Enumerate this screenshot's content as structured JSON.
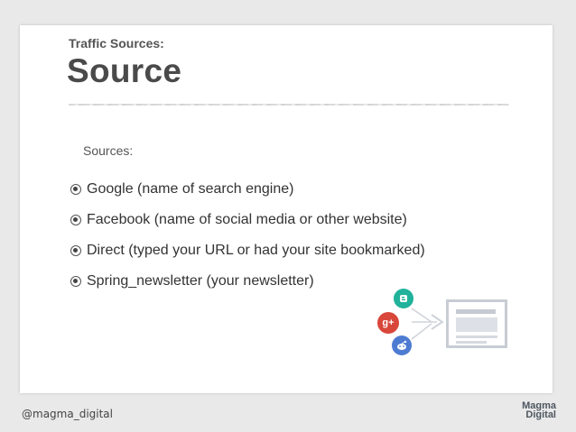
{
  "slide": {
    "kicker": "Traffic Sources:",
    "title": "Source",
    "subhead": "Sources:",
    "bullets": [
      "Google (name of search engine)",
      "Facebook (name of social media or other website)",
      "Direct (typed your URL or had your site bookmarked)",
      "Spring_newsletter (your newsletter)"
    ]
  },
  "illustration": {
    "icons": [
      "blogger-icon",
      "google-plus-icon",
      "reddit-icon",
      "arrow-icon",
      "monitor-icon"
    ],
    "gplus_text": "g+",
    "colors": {
      "blogger": "#21b29b",
      "gplus": "#d8473a",
      "reddit": "#4e7bd2",
      "monitor": "#c8ccd3"
    }
  },
  "footer": {
    "handle": "@magma_digital",
    "logo_line1": "Magma",
    "logo_line2": "Digital"
  }
}
